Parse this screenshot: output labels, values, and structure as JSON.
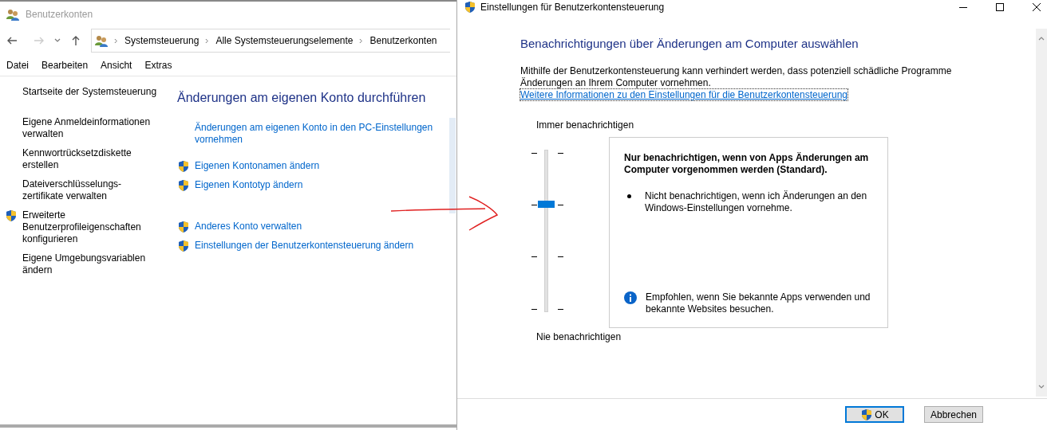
{
  "left_window": {
    "title": "Benutzerkonten",
    "breadcrumb": [
      "Systemsteuerung",
      "Alle Systemsteuerungselemente",
      "Benutzerkonten"
    ],
    "menu": [
      "Datei",
      "Bearbeiten",
      "Ansicht",
      "Extras"
    ],
    "sidebar": {
      "items": [
        {
          "label": "Startseite der Systemsteuerung",
          "shield": false
        },
        {
          "label": "Eigene Anmeldeinformationen verwalten",
          "shield": false
        },
        {
          "label": "Kennwortrücksetzdiskette erstellen",
          "shield": false
        },
        {
          "label": "Dateiverschlüsselungs-zertifikate verwalten",
          "shield": false
        },
        {
          "label": "Erweiterte Benutzerprofileigenschaften konfigurieren",
          "shield": true
        },
        {
          "label": "Eigene Umgebungsvariablen ändern",
          "shield": false
        }
      ]
    },
    "heading": "Änderungen am eigenen Konto durchführen",
    "task_groups": [
      [
        {
          "label": "Änderungen am eigenen Konto in den PC-Einstellungen vornehmen",
          "shield": false
        }
      ],
      [
        {
          "label": "Eigenen Kontonamen ändern",
          "shield": true
        },
        {
          "label": "Eigenen Kontotyp ändern",
          "shield": true
        }
      ],
      [
        {
          "label": "Anderes Konto verwalten",
          "shield": true
        },
        {
          "label": "Einstellungen der Benutzerkontensteuerung ändern",
          "shield": true
        }
      ]
    ]
  },
  "dialog": {
    "title": "Einstellungen für Benutzerkontensteuerung",
    "heading": "Benachrichtigungen über Änderungen am Computer auswählen",
    "description": "Mithilfe der Benutzerkontensteuerung kann verhindert werden, dass potenziell schädliche Programme Änderungen an Ihrem Computer vornehmen.",
    "link": "Weitere Informationen zu den Einstellungen für die Benutzerkontensteuerung",
    "slider": {
      "top_label": "Immer benachrichtigen",
      "bottom_label": "Nie benachrichtigen",
      "level": 0.67
    },
    "info": {
      "title": "Nur benachrichtigen, wenn von Apps Änderungen am Computer vorgenommen werden (Standard).",
      "bullets": [
        "Nicht benachrichtigen, wenn ich Änderungen an den Windows-Einstellungen vornehme."
      ],
      "note": "Empfohlen, wenn Sie bekannte Apps verwenden und bekannte Websites besuchen."
    },
    "buttons": [
      {
        "label": "OK",
        "shield": true,
        "default": true
      },
      {
        "label": "Abbrechen",
        "shield": false,
        "default": false
      }
    ]
  }
}
